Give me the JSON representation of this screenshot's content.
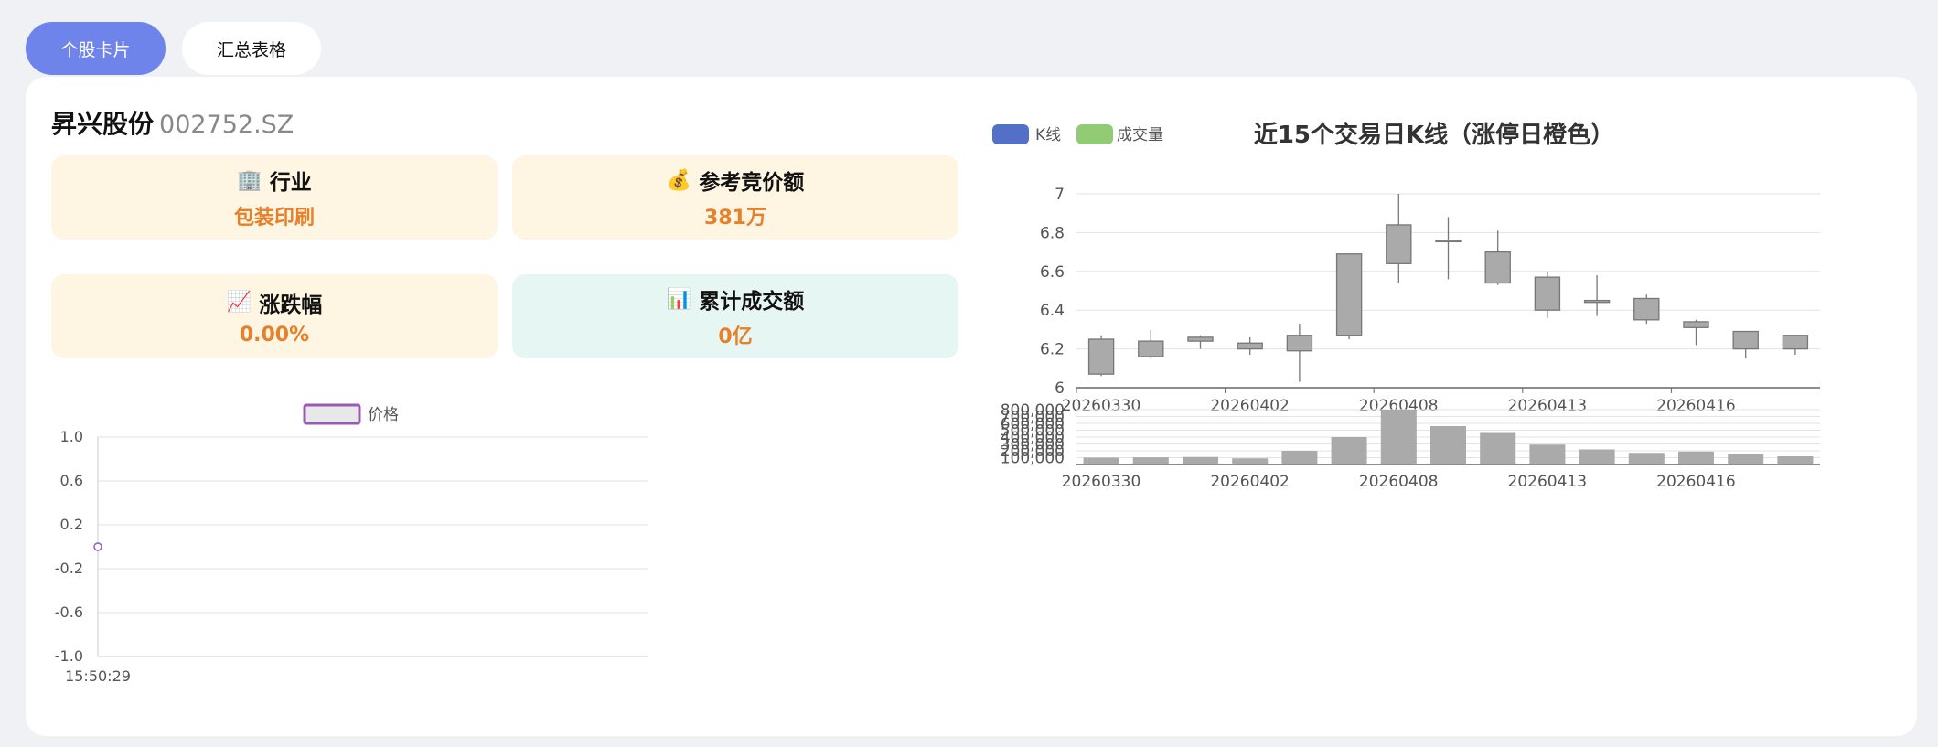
{
  "tabs": [
    {
      "label": "个股卡片",
      "active": true
    },
    {
      "label": "汇总表格",
      "active": false
    }
  ],
  "stock": {
    "name": "昇兴股份",
    "code": "002752.SZ"
  },
  "cards": [
    {
      "icon": "🏢",
      "label": "行业",
      "value": "包装印刷",
      "icon_name": "building-icon"
    },
    {
      "icon": "💰",
      "label": "参考竞价额",
      "value": "381万",
      "icon_name": "money-bag-icon"
    },
    {
      "icon": "📈",
      "label": "涨跌幅",
      "value": "0.00%",
      "icon_name": "chart-up-icon"
    },
    {
      "icon": "📊",
      "label": "累计成交额",
      "value": "0亿",
      "icon_name": "bar-chart-icon"
    }
  ],
  "colors": {
    "accent": "#6f84ea",
    "value_orange": "#e6802a",
    "kline_legend": "#5470c6",
    "volume_legend": "#91cc75",
    "price_line": "#9b59b6",
    "candle": "#aaaaaa"
  },
  "chart_data": [
    {
      "type": "line",
      "legend": [
        "价格"
      ],
      "x": [
        "15:50:29"
      ],
      "series": [
        {
          "name": "价格",
          "values": [
            0.0
          ]
        }
      ],
      "ylim": [
        -1.0,
        1.0
      ],
      "yticks": [
        "1.0",
        "0.6",
        "0.2",
        "-0.2",
        "-0.6",
        "-1.0"
      ]
    },
    {
      "type": "candlestick",
      "title": "近15个交易日K线（涨停日橙色）",
      "legend": [
        "K线",
        "成交量"
      ],
      "ylim": [
        6,
        7
      ],
      "yticks": [
        "7",
        "6.8",
        "6.6",
        "6.4",
        "6.2",
        "6"
      ],
      "xticks": [
        "20260330",
        "20260402",
        "20260408",
        "20260413",
        "20260416"
      ],
      "candles": [
        {
          "open": 6.07,
          "close": 6.25,
          "low": 6.06,
          "high": 6.27
        },
        {
          "open": 6.16,
          "close": 6.24,
          "low": 6.15,
          "high": 6.3
        },
        {
          "open": 6.24,
          "close": 6.26,
          "low": 6.2,
          "high": 6.27
        },
        {
          "open": 6.2,
          "close": 6.23,
          "low": 6.17,
          "high": 6.26
        },
        {
          "open": 6.19,
          "close": 6.27,
          "low": 6.03,
          "high": 6.33
        },
        {
          "open": 6.27,
          "close": 6.69,
          "low": 6.25,
          "high": 6.69
        },
        {
          "open": 6.64,
          "close": 6.84,
          "low": 6.54,
          "high": 7.0
        },
        {
          "open": 6.76,
          "close": 6.76,
          "low": 6.56,
          "high": 6.88
        },
        {
          "open": 6.7,
          "close": 6.54,
          "low": 6.53,
          "high": 6.81
        },
        {
          "open": 6.57,
          "close": 6.4,
          "low": 6.36,
          "high": 6.6
        },
        {
          "open": 6.45,
          "close": 6.44,
          "low": 6.37,
          "high": 6.58
        },
        {
          "open": 6.46,
          "close": 6.35,
          "low": 6.33,
          "high": 6.48
        },
        {
          "open": 6.34,
          "close": 6.31,
          "low": 6.22,
          "high": 6.35
        },
        {
          "open": 6.29,
          "close": 6.2,
          "low": 6.15,
          "high": 6.29
        },
        {
          "open": 6.27,
          "close": 6.2,
          "low": 6.17,
          "high": 6.27
        }
      ],
      "volume": {
        "yticks": [
          "800,000",
          "700,000",
          "600,000",
          "500,000",
          "400,000",
          "300,000",
          "200,000",
          "100,000"
        ],
        "ymax": 800000,
        "values": [
          100000,
          105000,
          110000,
          90000,
          200000,
          400000,
          800000,
          560000,
          460000,
          290000,
          220000,
          170000,
          190000,
          150000,
          120000
        ]
      }
    }
  ]
}
